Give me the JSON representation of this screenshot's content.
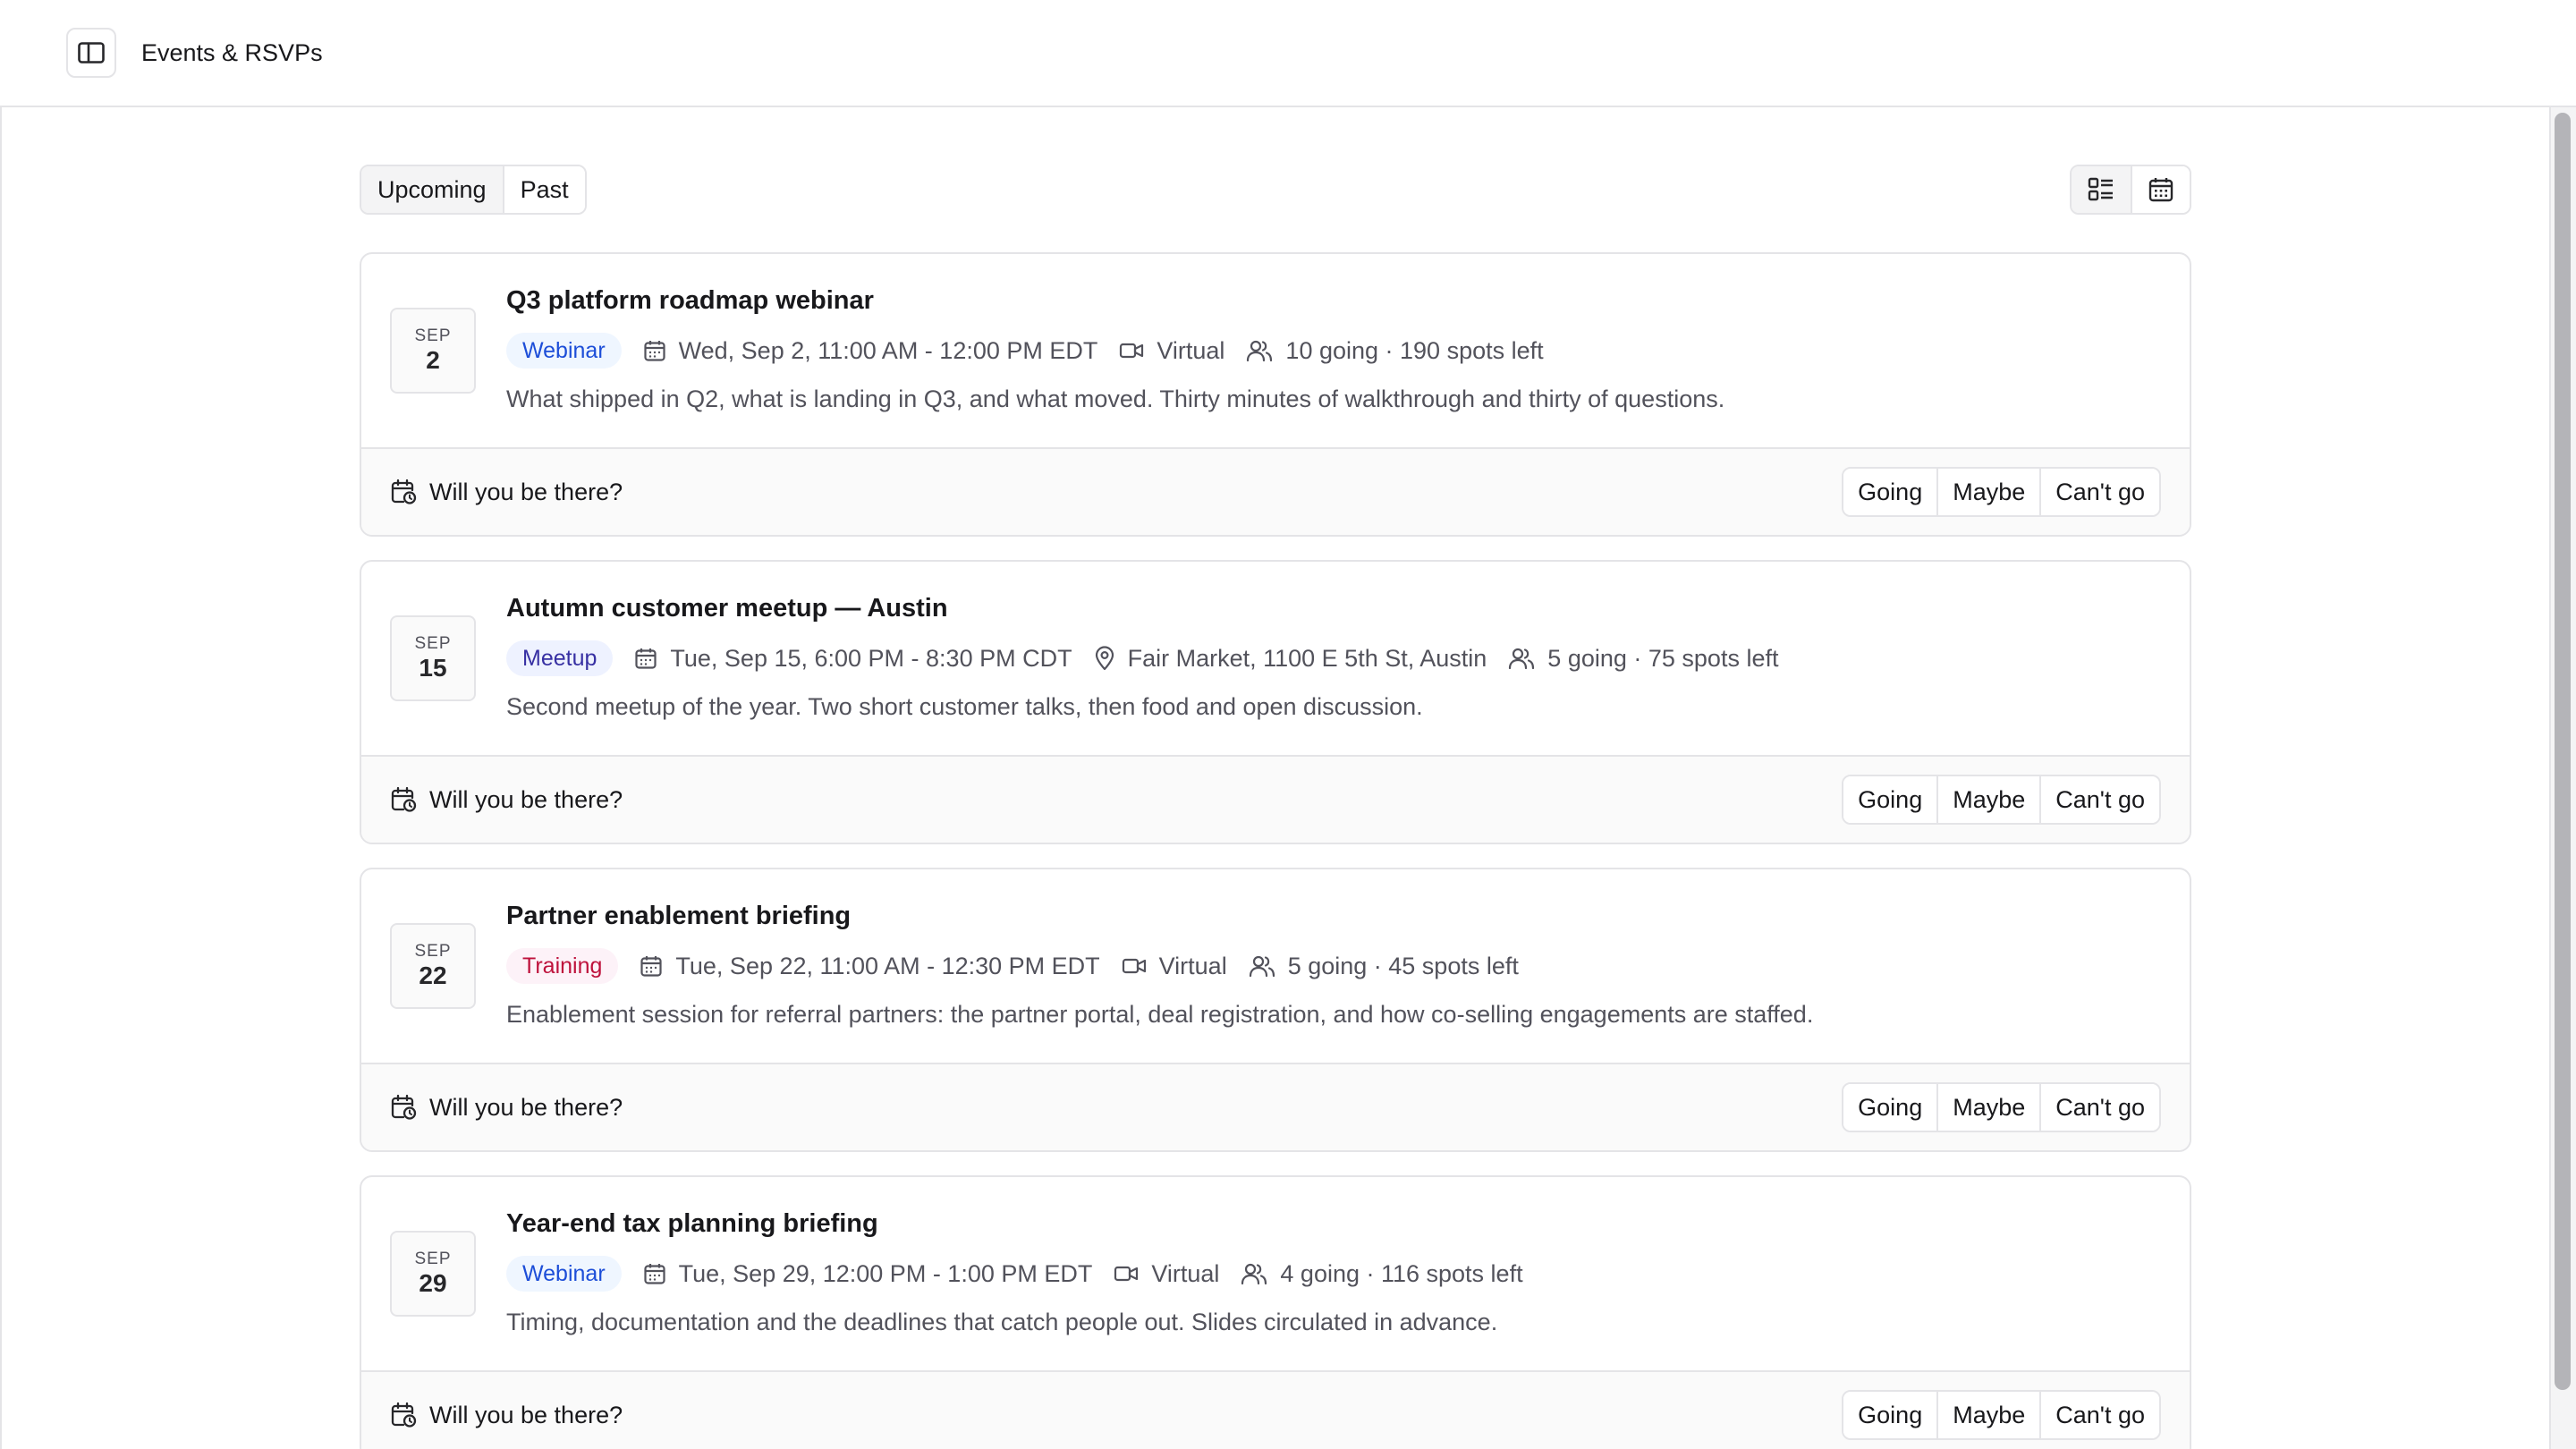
{
  "app": {
    "title": "Events & RSVPs"
  },
  "tabs": [
    {
      "label": "Upcoming",
      "active": true
    },
    {
      "label": "Past",
      "active": false
    }
  ],
  "view_toggle": {
    "list_icon": "list-view-icon",
    "calendar_icon": "calendar-view-icon",
    "active": "list"
  },
  "colors": {
    "webinar_bg": "#eff6ff",
    "webinar_fg": "#1d4ed8",
    "meetup_bg": "#eef2ff",
    "meetup_fg": "#3730a3",
    "training_bg": "#fdf2f8",
    "training_fg": "#be123c"
  },
  "rsvp": {
    "prompt": "Will you be there?",
    "going": "Going",
    "maybe": "Maybe",
    "cant": "Can't go"
  },
  "events": [
    {
      "month": "SEP",
      "day": "2",
      "title": "Q3 platform roadmap webinar",
      "tag": "Webinar",
      "tag_type": "webinar",
      "datetime": "Wed, Sep 2, 11:00 AM - 12:00 PM EDT",
      "location_type": "virtual",
      "location": "Virtual",
      "attendance": "10 going · 190 spots left",
      "description": "What shipped in Q2, what is landing in Q3, and what moved. Thirty minutes of walkthrough and thirty of questions."
    },
    {
      "month": "SEP",
      "day": "15",
      "title": "Autumn customer meetup — Austin",
      "tag": "Meetup",
      "tag_type": "meetup",
      "datetime": "Tue, Sep 15, 6:00 PM - 8:30 PM CDT",
      "location_type": "place",
      "location": "Fair Market, 1100 E 5th St, Austin",
      "attendance": "5 going · 75 spots left",
      "description": "Second meetup of the year. Two short customer talks, then food and open discussion."
    },
    {
      "month": "SEP",
      "day": "22",
      "title": "Partner enablement briefing",
      "tag": "Training",
      "tag_type": "training",
      "datetime": "Tue, Sep 22, 11:00 AM - 12:30 PM EDT",
      "location_type": "virtual",
      "location": "Virtual",
      "attendance": "5 going · 45 spots left",
      "description": "Enablement session for referral partners: the partner portal, deal registration, and how co-selling engagements are staffed."
    },
    {
      "month": "SEP",
      "day": "29",
      "title": "Year-end tax planning briefing",
      "tag": "Webinar",
      "tag_type": "webinar",
      "datetime": "Tue, Sep 29, 12:00 PM - 1:00 PM EDT",
      "location_type": "virtual",
      "location": "Virtual",
      "attendance": "4 going · 116 spots left",
      "description": "Timing, documentation and the deadlines that catch people out. Slides circulated in advance."
    }
  ]
}
